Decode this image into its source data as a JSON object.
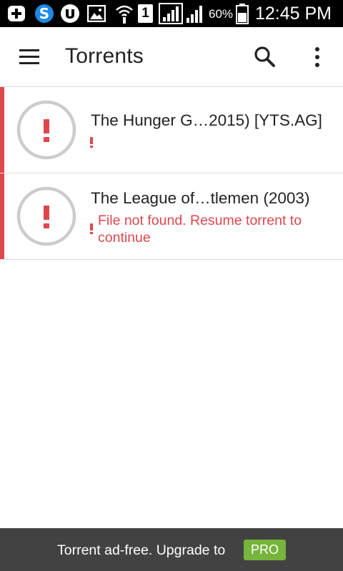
{
  "status_bar": {
    "icons": [
      "add-box-icon",
      "s-app-icon",
      "utorrent-icon",
      "image-icon",
      "wifi-icon",
      "sim-1-icon",
      "signal-icon",
      "signal-icon",
      "battery-icon"
    ],
    "sim_label": "1",
    "battery_percent": "60%",
    "time": "12:45 PM"
  },
  "app_bar": {
    "title": "Torrents",
    "icons": [
      "menu-icon",
      "search-icon",
      "more-vert-icon"
    ]
  },
  "torrents": [
    {
      "name": "The Hunger G…2015) [YTS.AG]",
      "status_icon": "error-icon",
      "error_text": ""
    },
    {
      "name": "The League of…tlemen (2003)",
      "status_icon": "error-icon",
      "error_text": "File not found. Resume torrent to continue"
    }
  ],
  "banner": {
    "text": "Torrent ad-free. Upgrade to",
    "badge": "PRO"
  },
  "colors": {
    "error": "#e0474c",
    "ring": "#cccccc",
    "banner_bg": "#424242",
    "pro_badge": "#76b43b",
    "status_bar_bg": "#000000"
  }
}
